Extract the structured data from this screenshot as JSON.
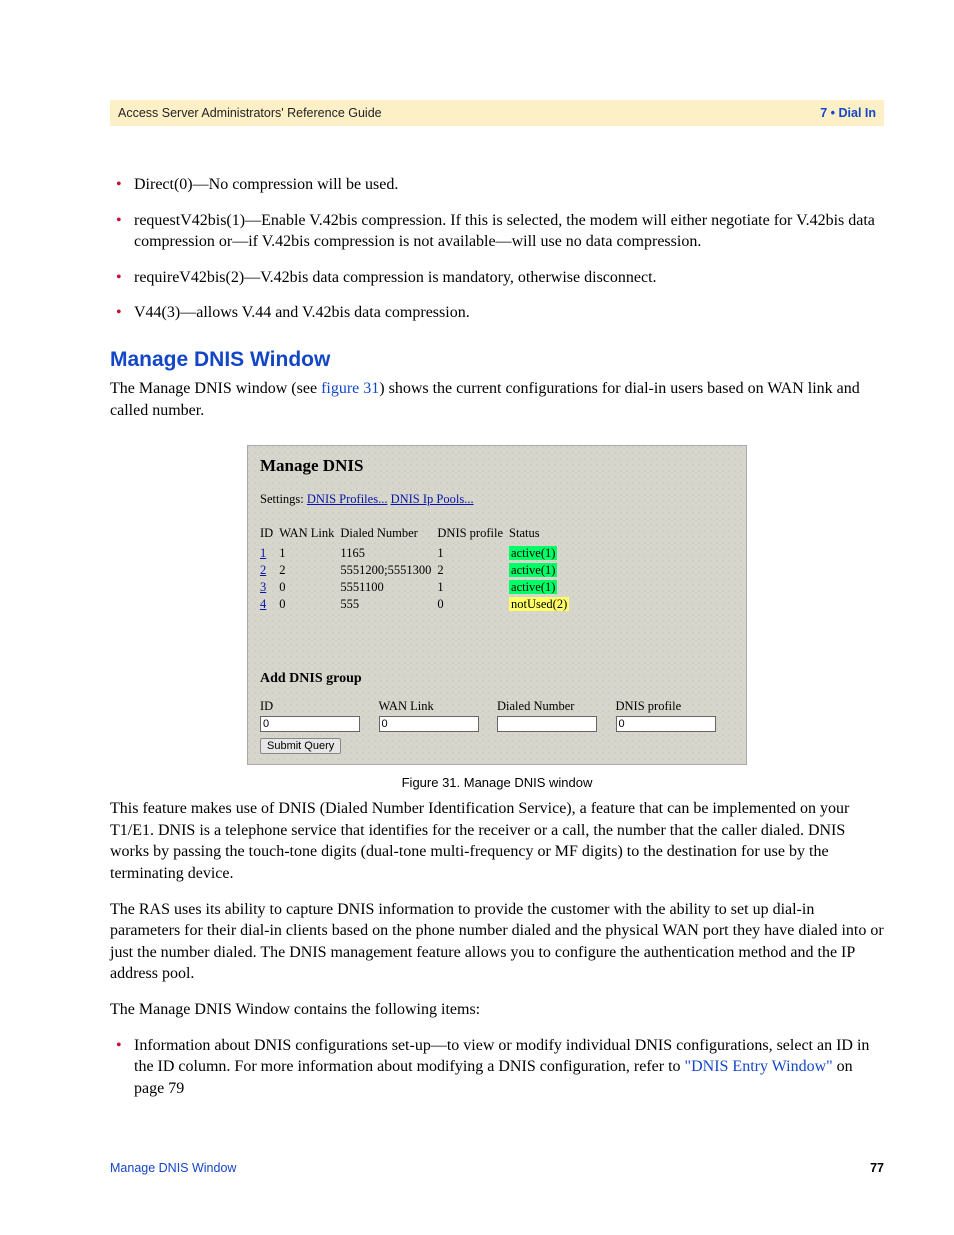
{
  "header": {
    "left": "Access Server Administrators' Reference Guide",
    "right": "7 • Dial In"
  },
  "bullets_top": [
    "Direct(0)—No compression will be used.",
    "requestV42bis(1)—Enable V.42bis compression. If this is selected, the modem will either negotiate for V.42bis data compression or—if V.42bis compression is not available—will use no data compression.",
    "requireV42bis(2)—V.42bis data compression is mandatory, otherwise disconnect.",
    "V44(3)—allows V.44 and V.42bis data compression."
  ],
  "section_title": "Manage DNIS Window",
  "intro": {
    "pre": "The Manage DNIS window (see ",
    "link": "figure 31",
    "post": ") shows the current configurations for dial-in users based on WAN link and called number."
  },
  "figure": {
    "title": "Manage DNIS",
    "settings_label": "Settings:",
    "settings_link1": "DNIS Profiles...",
    "settings_link2": "DNIS Ip Pools...",
    "columns": {
      "id": "ID",
      "wan": "WAN Link",
      "dialed": "Dialed Number",
      "profile": "DNIS profile",
      "status": "Status"
    },
    "rows": [
      {
        "id": "1",
        "wan": "1",
        "dialed": "1165",
        "profile": "1",
        "status": "active(1)",
        "status_class": "status-active"
      },
      {
        "id": "2",
        "wan": "2",
        "dialed": "5551200;5551300",
        "profile": "2",
        "status": "active(1)",
        "status_class": "status-active"
      },
      {
        "id": "3",
        "wan": "0",
        "dialed": "5551100",
        "profile": "1",
        "status": "active(1)",
        "status_class": "status-active"
      },
      {
        "id": "4",
        "wan": "0",
        "dialed": "555",
        "profile": "0",
        "status": "notUsed(2)",
        "status_class": "status-notused"
      }
    ],
    "add_title": "Add DNIS group",
    "add_cols": {
      "id": "ID",
      "wan": "WAN Link",
      "dialed": "Dialed Number",
      "profile": "DNIS profile"
    },
    "add_values": {
      "id": "0",
      "wan": "0",
      "dialed": "",
      "profile": "0"
    },
    "submit": "Submit Query",
    "caption": "Figure 31. Manage DNIS window"
  },
  "para1": "This feature makes use of DNIS (Dialed Number Identification Service), a feature that can be implemented on your T1/E1. DNIS is a telephone service that identifies for the receiver or a call, the number that the caller dialed. DNIS works by passing the touch-tone digits (dual-tone multi-frequency or MF digits) to the destination for use by the terminating device.",
  "para2": "The RAS uses its ability to capture DNIS information to provide the customer with the ability to set up dial-in parameters for their dial-in clients based on the phone number dialed and the physical WAN port they have dialed into or just the number dialed. The DNIS management feature allows you to configure the authentication method and the IP address pool.",
  "para3": "The Manage DNIS Window contains the following items:",
  "bullets_bottom": [
    {
      "pre": "Information about DNIS configurations set-up—to view or modify individual DNIS configurations, select an ID in the ID column. For more information about modifying a DNIS configuration, refer to ",
      "link": "\"DNIS Entry Window\"",
      "post": " on page 79"
    }
  ],
  "footer": {
    "left": "Manage DNIS Window",
    "right": "77"
  }
}
